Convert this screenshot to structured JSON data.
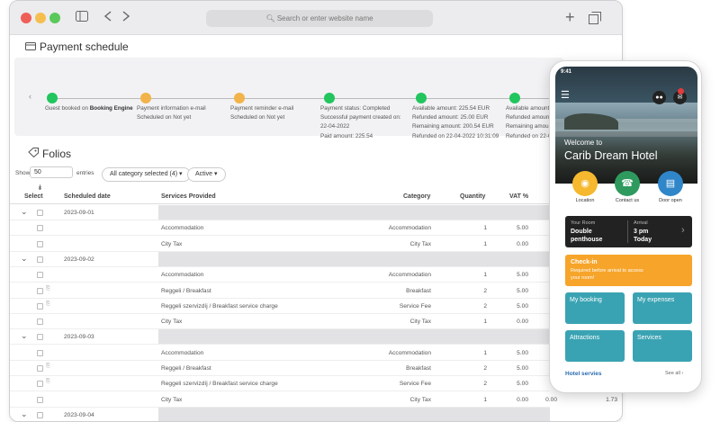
{
  "browser": {
    "url_placeholder": "Search or enter website name"
  },
  "payment": {
    "title": "Payment schedule",
    "steps": [
      {
        "lines": [
          "Guest booked on ",
          "Booking Engine"
        ],
        "color": "#22c55e"
      },
      {
        "lines": [
          "Payment information e-mail",
          "Scheduled on Not yet"
        ],
        "color": "#f2b34a"
      },
      {
        "lines": [
          "Payment reminder e-mail",
          "Scheduled on Not yet"
        ],
        "color": "#f2b34a"
      },
      {
        "lines": [
          "Payment status: Completed",
          "Successful payment created on:",
          "22-04-2022",
          "Paid amount: 225.54"
        ],
        "color": "#22c55e"
      },
      {
        "lines": [
          "Available amount: 225.54 EUR",
          "Refunded amount: 25.00 EUR",
          "Remaining amount: 200.54 EUR",
          "Refunded on 22-04-2022 10:31:09"
        ],
        "color": "#22c55e"
      },
      {
        "lines": [
          "Available amount: 2",
          "Refunded amount: 2",
          "Remaining amount: 1",
          "Refunded on 22-04-"
        ],
        "color": "#22c55e"
      }
    ]
  },
  "folios": {
    "title": "Folios",
    "show_label": "Show",
    "show_value": "50",
    "entries_label": "entries",
    "category_filter": "All category selected (4)",
    "status_filter": "Active",
    "headers": {
      "select": "Select",
      "date": "Scheduled date",
      "services": "Services Provided",
      "category": "Category",
      "quantity": "Quantity",
      "vat": "VAT %"
    },
    "groups": [
      {
        "date": "2023-09-01",
        "rows": [
          {
            "s": "Accommodation",
            "c": "Accommodation",
            "q": "1",
            "v": "5.00"
          },
          {
            "s": "City Tax",
            "c": "City Tax",
            "q": "1",
            "v": "0.00"
          }
        ]
      },
      {
        "date": "2023-09-02",
        "rows": [
          {
            "s": "Accommodation",
            "c": "Accommodation",
            "q": "1",
            "v": "5.00"
          },
          {
            "s": "Reggeli / Breakfast",
            "c": "Breakfast",
            "q": "2",
            "v": "5.00"
          },
          {
            "s": "Reggeli szervizdíj / Breakfast service charge",
            "c": "Service Fee",
            "q": "2",
            "v": "5.00"
          },
          {
            "s": "City Tax",
            "c": "City Tax",
            "q": "1",
            "v": "0.00"
          }
        ]
      },
      {
        "date": "2023-09-03",
        "rows": [
          {
            "s": "Accommodation",
            "c": "Accommodation",
            "q": "1",
            "v": "5.00"
          },
          {
            "s": "Reggeli / Breakfast",
            "c": "Breakfast",
            "q": "2",
            "v": "5.00"
          },
          {
            "s": "Reggeli szervizdíj / Breakfast service charge",
            "c": "Service Fee",
            "q": "2",
            "v": "5.00"
          },
          {
            "s": "City Tax",
            "c": "City Tax",
            "q": "1",
            "v": "0.00",
            "x1": "0.00",
            "x2": "1.73"
          }
        ]
      },
      {
        "date": "2023-09-04",
        "rows": []
      }
    ]
  },
  "phone": {
    "time": "9:41",
    "welcome": "Welcome to",
    "hotel": "Carib Dream Hotel",
    "actions": [
      {
        "label": "Location",
        "color": "#f5b82e"
      },
      {
        "label": "Contact us",
        "color": "#2e9a5e"
      },
      {
        "label": "Door open",
        "color": "#2f86c9"
      }
    ],
    "room": {
      "label": "Your Room",
      "value1": "Double",
      "value2": "penthouse",
      "arr_label": "Arrival",
      "arr1": "3 pm",
      "arr2": "Today"
    },
    "checkin": {
      "title": "Check-in",
      "sub1": "Required before arrival to access",
      "sub2": "your room!"
    },
    "tiles": [
      "My booking",
      "My expenses",
      "Attractions",
      "Services"
    ],
    "hotel_services": "Hotel servies",
    "see_all": "See all"
  }
}
